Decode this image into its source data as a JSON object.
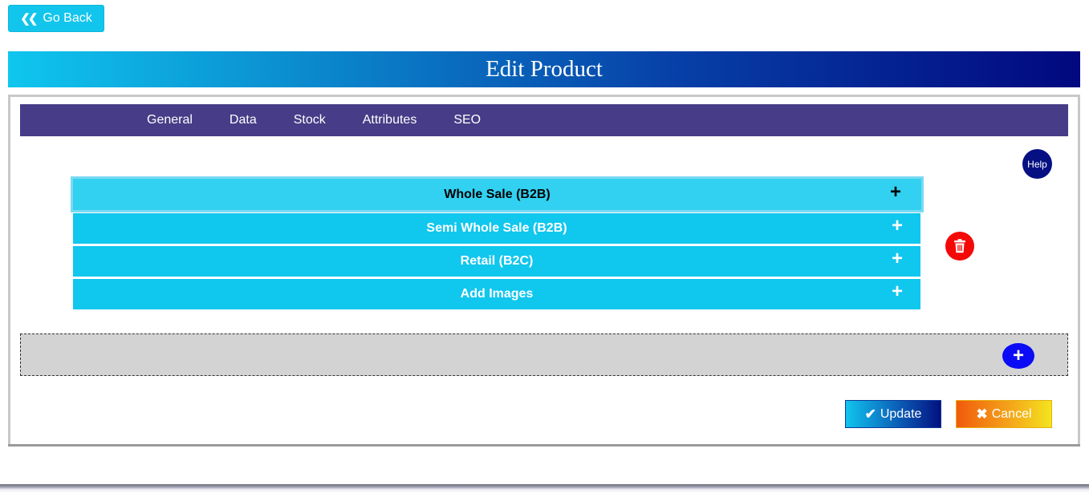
{
  "header": {
    "go_back": {
      "icon": "double-chevron-left-icon",
      "label": "Go Back"
    },
    "title": "Edit Product"
  },
  "tabs": [
    {
      "label": "General"
    },
    {
      "label": "Data"
    },
    {
      "label": "Stock"
    },
    {
      "label": "Attributes"
    },
    {
      "label": "SEO"
    }
  ],
  "help": {
    "label": "Help"
  },
  "accordion": [
    {
      "label": "Whole Sale (B2B)",
      "icon": "+",
      "active": true
    },
    {
      "label": "Semi Whole Sale (B2B)",
      "icon": "+"
    },
    {
      "label": "Retail (B2C)",
      "icon": "+"
    },
    {
      "label": "Add Images",
      "icon": "+"
    }
  ],
  "dropzone": {
    "add_icon": "+"
  },
  "actions": {
    "update": {
      "icon": "check-icon",
      "label": "Update"
    },
    "cancel": {
      "icon": "times-icon",
      "label": "Cancel"
    }
  },
  "colors": {
    "accent_cyan": "#10c7ee",
    "tab_bar": "#473c87",
    "help": "#061083",
    "delete": "#f50808",
    "add": "#0b0bf5"
  }
}
